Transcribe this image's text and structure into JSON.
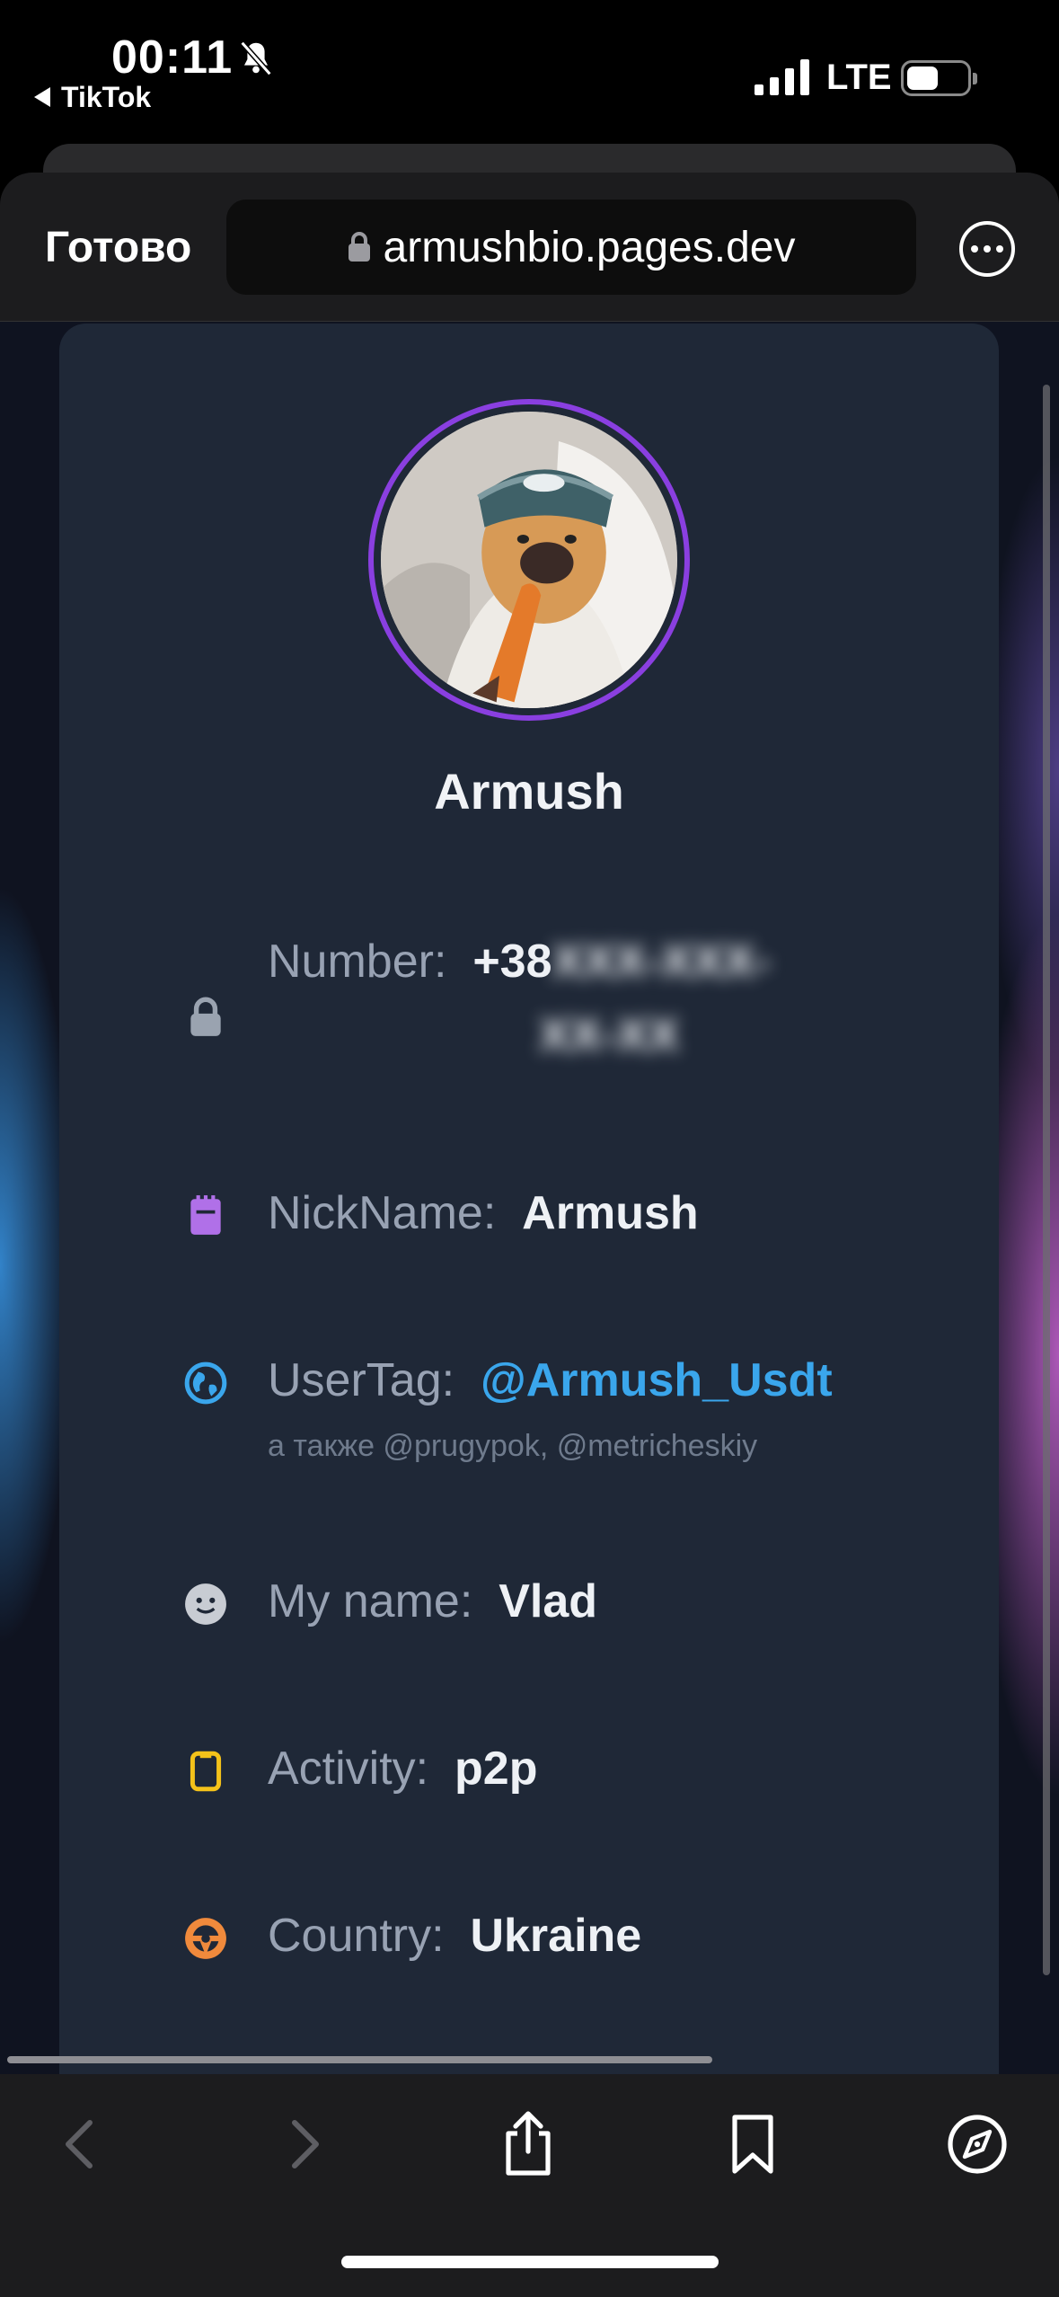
{
  "status_bar": {
    "time": "00:11",
    "back_app": "TikTok",
    "network": "LTE",
    "icons": [
      "bell-off-icon",
      "signal-icon",
      "battery-icon"
    ]
  },
  "browser": {
    "done_label": "Готово",
    "url": "armushbio.pages.dev",
    "more_icon": "ellipsis-circle-icon",
    "toolbar_icons": [
      "back-icon",
      "forward-icon",
      "share-icon",
      "bookmarks-icon",
      "compass-icon"
    ]
  },
  "profile": {
    "display_name": "Armush",
    "avatar": "dog-in-hat-avatar",
    "ring_color": "#8a3fe0",
    "rows": [
      {
        "label": "Number:",
        "value": "+38",
        "blurred_line1": "XXX-XXX-",
        "blurred_line2": "XX-XX",
        "icon": "lock-icon",
        "icon_color": "#9aa3b0"
      },
      {
        "label": "NickName:",
        "value": "Armush",
        "icon": "notepad-icon",
        "icon_color": "#b070e8"
      },
      {
        "label": "UserTag:",
        "value": "@Armush_Usdt",
        "sub": "а также @prugypok, @metricheskiy",
        "icon": "globe-icon",
        "icon_color": "#3aa6ec"
      },
      {
        "label": "My name:",
        "value": "Vlad",
        "icon": "smiley-icon",
        "icon_color": "#c8ccd3"
      },
      {
        "label": "Activity:",
        "value": "p2p",
        "icon": "phone-icon",
        "icon_color": "#f4c21a"
      },
      {
        "label": "Country:",
        "value": "Ukraine",
        "icon": "steering-wheel-icon",
        "icon_color": "#f08a3c"
      }
    ]
  }
}
